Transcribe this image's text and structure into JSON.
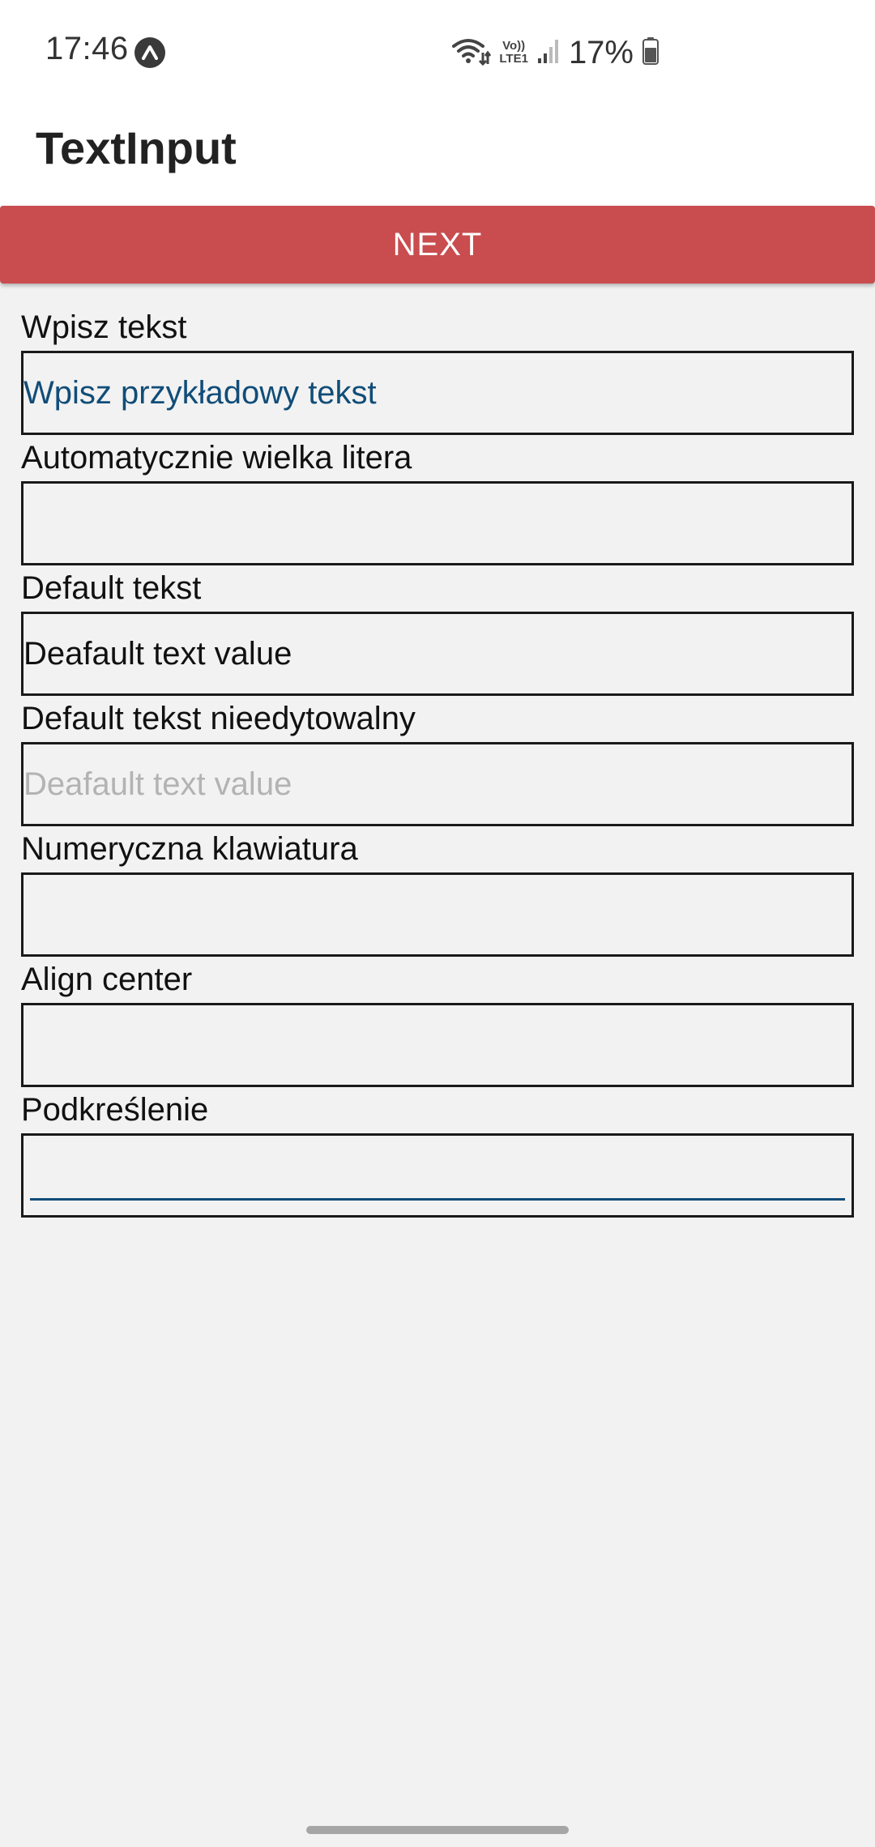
{
  "status_bar": {
    "time": "17:46",
    "app_icon": "expo-icon",
    "icons": [
      "wifi-icon",
      "volte-lte-icon",
      "signal-bars-icon"
    ],
    "volte_label_top": "Vo))",
    "volte_label_bottom": "LTE1",
    "battery_percent": "17%",
    "battery_icon": "battery-icon"
  },
  "app_bar": {
    "title": "TextInput"
  },
  "next_button": {
    "label": "NEXT",
    "color": "#c94c4f"
  },
  "fields": [
    {
      "label": "Wpisz tekst",
      "value": "",
      "placeholder": "Wpisz przykładowy tekst"
    },
    {
      "label": "Automatycznie wielka litera",
      "value": "",
      "placeholder": ""
    },
    {
      "label": "Default tekst",
      "value": "Deafault text value",
      "placeholder": ""
    },
    {
      "label": "Default tekst nieedytowalny",
      "value": "Deafault text value",
      "placeholder": "",
      "editable": false
    },
    {
      "label": "Numeryczna klawiatura",
      "value": "",
      "placeholder": ""
    },
    {
      "label": "Align center",
      "value": "",
      "placeholder": ""
    },
    {
      "label": "Podkreślenie",
      "value": "",
      "placeholder": "",
      "underline_color": "#114d78"
    }
  ],
  "colors": {
    "background": "#f2f2f2",
    "accent_blue": "#114d78",
    "disabled_text": "#b3b3b3"
  }
}
